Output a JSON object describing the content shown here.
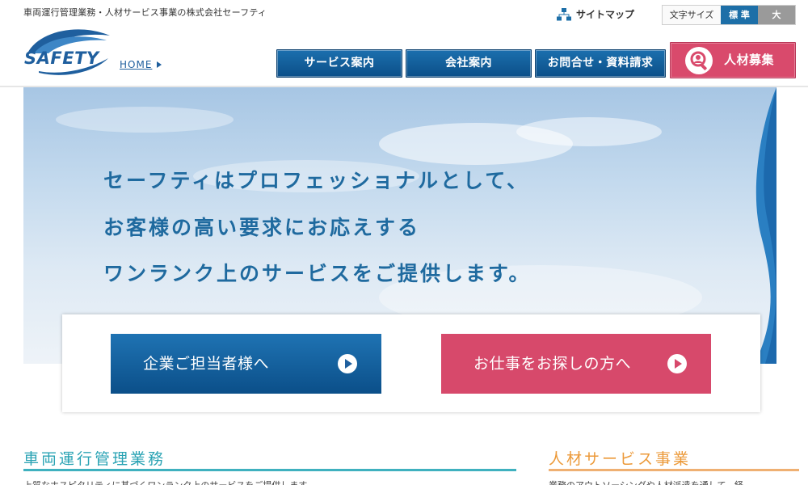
{
  "header": {
    "tagline": "車両運行管理業務・人材サービス事業の株式会社セーフティ",
    "sitemap_label": "サイトマップ",
    "fontsize": {
      "label": "文字サイズ",
      "standard": "標 準",
      "large": "大"
    },
    "logo_text": "SAFETY",
    "breadcrumb_home": "HOME"
  },
  "nav": {
    "service": "サービス案内",
    "company": "会社案内",
    "contact": "お問合せ・資料請求",
    "recruit": "人材募集"
  },
  "hero": {
    "line1": "セーフティはプロフェッショナルとして、",
    "line2": "お客様の高い要求にお応えする",
    "line3": "ワンランク上のサービスをご提供します。"
  },
  "cta": {
    "corporate": "企業ご担当者様へ",
    "jobseeker": "お仕事をお探しの方へ"
  },
  "sections": {
    "vehicle_title": "車両運行管理業務",
    "vehicle_text": "上質なホスピタリティに基づくワンランク上のサービスをご提供します。",
    "hr_title": "人材サービス事業",
    "hr_text": "業務のアウトソーシングや人材派遣を通して、経"
  },
  "colors": {
    "brand_blue": "#1d6fa8",
    "recruit_pink": "#d94a6c",
    "vehicle_teal": "#2aa3b4",
    "hr_orange": "#ec9a3a"
  }
}
